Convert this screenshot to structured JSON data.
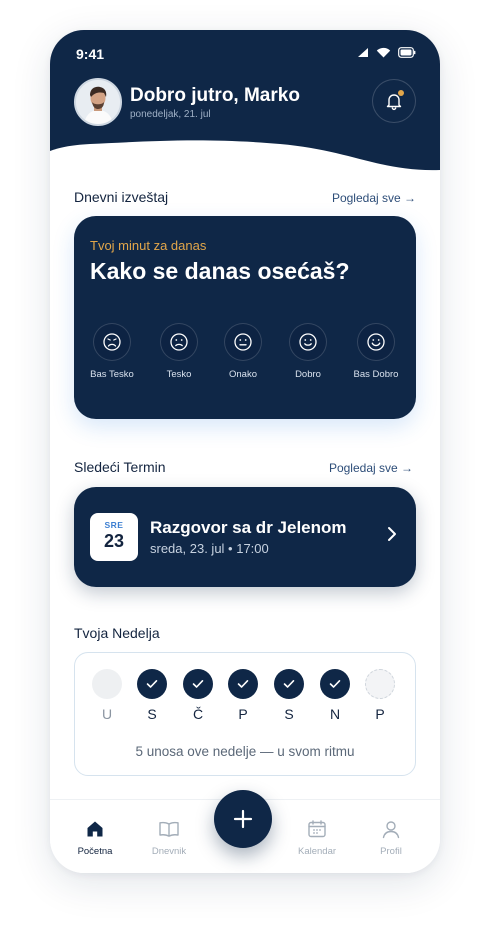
{
  "status_bar": {
    "time": "9:41"
  },
  "header": {
    "greeting": "Dobro jutro, Marko",
    "date": "ponedeljak, 21. jul"
  },
  "daily_report": {
    "title": "Dnevni izveštaj",
    "see_all": "Pogledaj sve →",
    "kicker": "Tvoj minut za danas",
    "question": "Kako se danas osećaš?",
    "moods": [
      {
        "label": "Bas Tesko",
        "icon": "very-sad-face-icon"
      },
      {
        "label": "Tesko",
        "icon": "sad-face-icon"
      },
      {
        "label": "Onako",
        "icon": "neutral-face-icon"
      },
      {
        "label": "Dobro",
        "icon": "happy-face-icon"
      },
      {
        "label": "Bas Dobro",
        "icon": "very-happy-face-icon"
      }
    ]
  },
  "next_appointment": {
    "title": "Sledeći Termin",
    "see_all": "Pogledaj sve →",
    "day_abbr": "SRE",
    "day_num": "23",
    "name": "Razgovor sa dr Jelenom",
    "when": "sreda, 23. jul • 17:00"
  },
  "week": {
    "title": "Tvoja Nedelja",
    "days": [
      {
        "label": "U",
        "state": "empty"
      },
      {
        "label": "S",
        "state": "done"
      },
      {
        "label": "Č",
        "state": "done"
      },
      {
        "label": "P",
        "state": "done"
      },
      {
        "label": "S",
        "state": "done"
      },
      {
        "label": "N",
        "state": "done"
      },
      {
        "label": "P",
        "state": "future"
      }
    ],
    "summary": "5 unosa ove nedelje — u svom ritmu"
  },
  "nav": {
    "items": [
      {
        "label": "Početna",
        "icon": "home-icon",
        "active": true
      },
      {
        "label": "Dnevnik",
        "icon": "book-icon",
        "active": false
      },
      {
        "label": "Kalendar",
        "icon": "calendar-icon",
        "active": false
      },
      {
        "label": "Profil",
        "icon": "user-icon",
        "active": false
      }
    ],
    "fab_icon": "plus-icon"
  },
  "colors": {
    "navy": "#0f2747",
    "accent": "#e2a64a",
    "link": "#2d4d78"
  }
}
